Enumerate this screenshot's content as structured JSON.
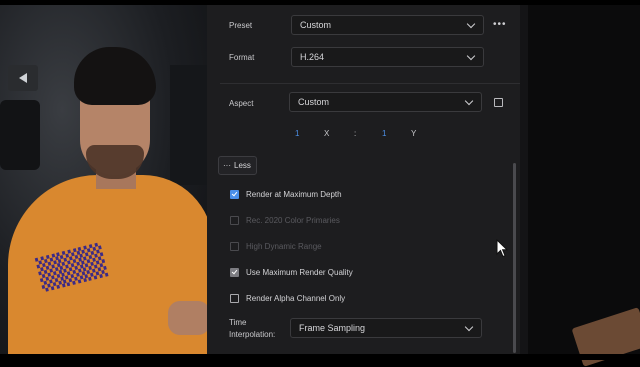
{
  "export_settings": {
    "preset": {
      "label": "Preset",
      "value": "Custom"
    },
    "format": {
      "label": "Format",
      "value": "H.264"
    },
    "aspect": {
      "label": "Aspect",
      "value": "Custom",
      "ratio_x_value": "1",
      "ratio_x_label": "X",
      "ratio_separator": ":",
      "ratio_y_value": "1",
      "ratio_y_label": "Y"
    },
    "less_button": {
      "dots": "···",
      "label": "Less"
    },
    "options": [
      {
        "label": "Render at Maximum Depth",
        "checked": true,
        "enabled": true
      },
      {
        "label": "Rec. 2020 Color Primaries",
        "checked": false,
        "enabled": false
      },
      {
        "label": "High Dynamic Range",
        "checked": false,
        "enabled": false
      },
      {
        "label": "Use Maximum Render Quality",
        "checked": true,
        "enabled": true
      },
      {
        "label": "Render Alpha Channel Only",
        "checked": false,
        "enabled": true
      }
    ],
    "time_interpolation": {
      "label_line1": "Time",
      "label_line2": "Interpolation:",
      "value": "Frame Sampling"
    }
  },
  "icons": {
    "more": "more-horizontal-icon",
    "chevron": "chevron-down-icon",
    "cursor": "mouse-pointer-icon"
  },
  "colors": {
    "panel_bg": "#1d1d1f",
    "accent_blue": "#4b8fe8",
    "text": "#d3d3d6",
    "disabled_text": "#5a5a5f"
  }
}
